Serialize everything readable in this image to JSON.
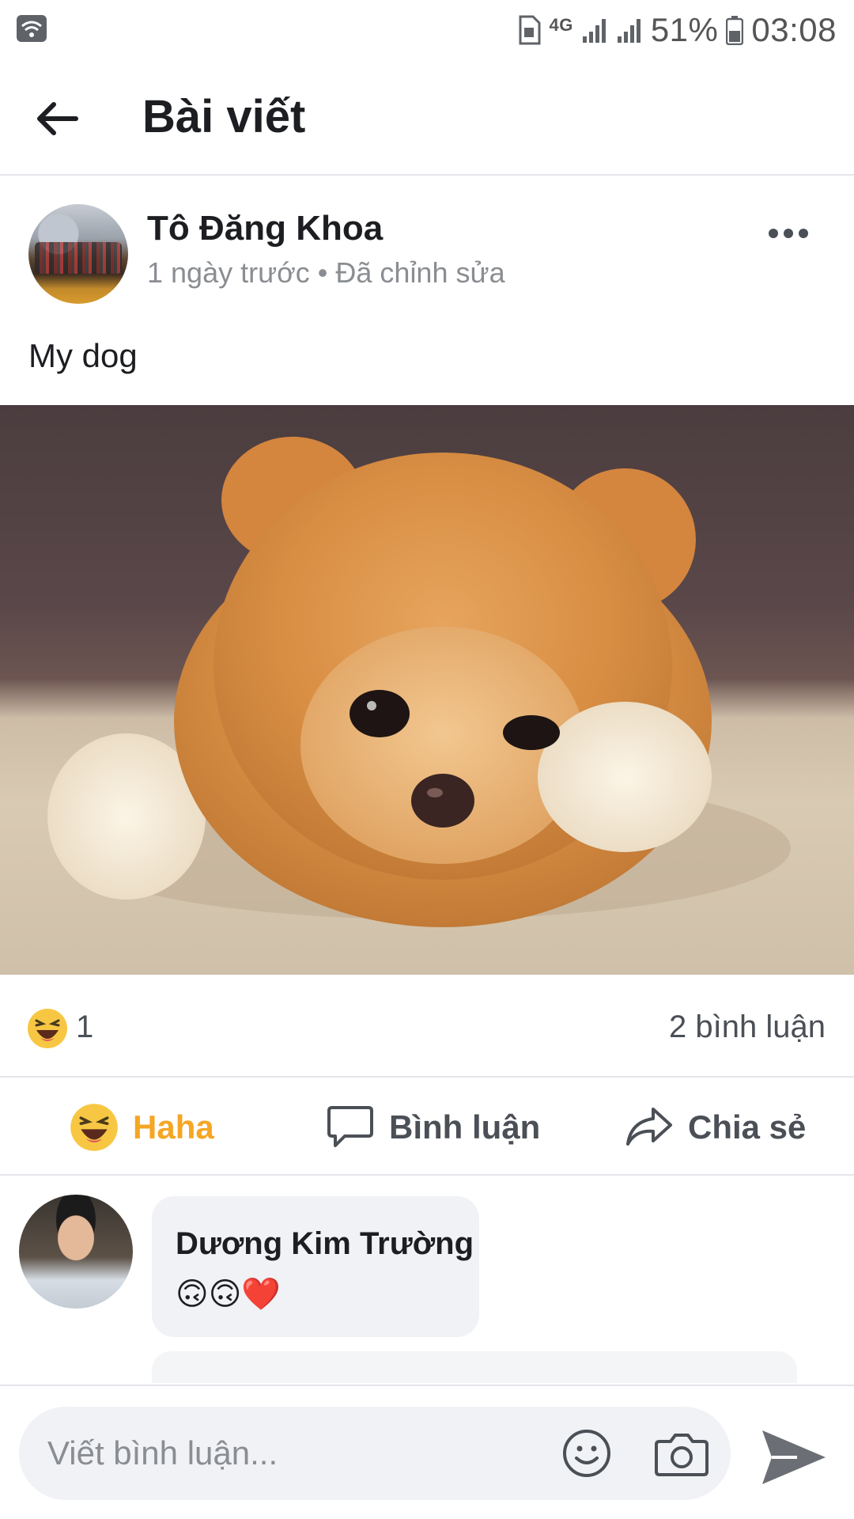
{
  "status_bar": {
    "network": "4G",
    "battery": "51%",
    "time": "03:08",
    "icons": [
      "wifi-icon",
      "sim-icon",
      "signal-icon",
      "battery-icon"
    ]
  },
  "header": {
    "title": "Bài viết",
    "back_icon": "arrow-left-icon"
  },
  "post": {
    "author": "Tô Đăng Khoa",
    "meta": "1 ngày trước • Đã chỉnh sửa",
    "text": "My dog",
    "image_subject": "pomeranian puppy"
  },
  "summary": {
    "reaction_icon": "haha-emoji-icon",
    "reaction_count": "1",
    "comment_count": "2 bình luận"
  },
  "actions": {
    "haha_label": "Haha",
    "comment_label": "Bình luận",
    "share_label": "Chia sẻ",
    "haha_color": "#f5a623"
  },
  "comment": {
    "author": "Dương Kim Trường",
    "body": "🙃🙃❤️"
  },
  "composer": {
    "placeholder": "Viết bình luận..."
  },
  "colors": {
    "divider": "#e4e6eb",
    "bubble": "#f0f2f5",
    "muted_text": "#8a8d91"
  }
}
